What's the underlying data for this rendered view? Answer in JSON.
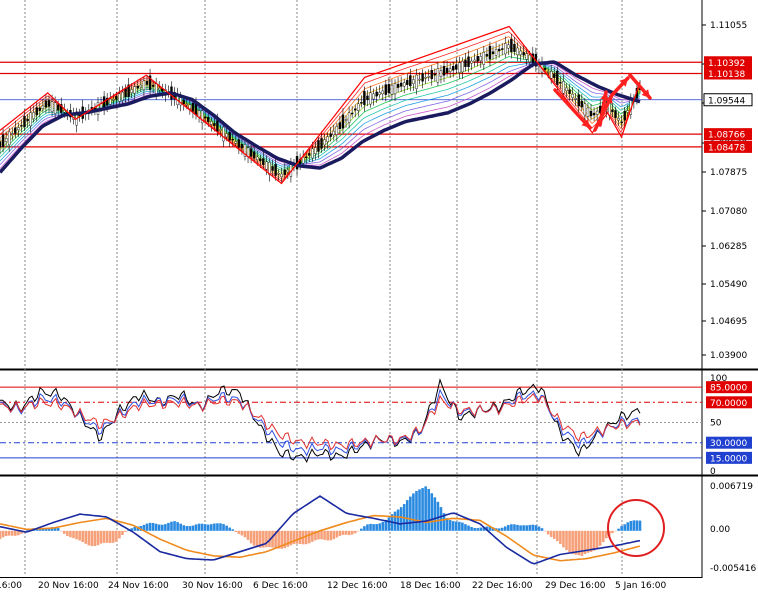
{
  "chart_data": [
    {
      "type": "candlestick",
      "ylim": [
        1.035,
        1.118
      ],
      "y_ticks": [
        "1.11055",
        "1.10260",
        "1.09465",
        "1.08670",
        "1.07875",
        "1.07080",
        "1.06285",
        "1.05490",
        "1.04695",
        "1.03900"
      ],
      "h_levels": [
        {
          "label": "1.10392",
          "value": 1.10392,
          "color": "#e00000"
        },
        {
          "label": "1.10138",
          "value": 1.10138,
          "color": "#e00000"
        },
        {
          "label": "1.09544",
          "value": 1.09544,
          "color": "#2040d0",
          "current": true
        },
        {
          "label": "1.08766",
          "value": 1.08766,
          "color": "#e00000"
        },
        {
          "label": "1.08478",
          "value": 1.08478,
          "color": "#e00000"
        }
      ],
      "x_labels": [
        "16:00",
        "20 Nov 16:00",
        "24 Nov 16:00",
        "30 Nov 16:00",
        "6 Dec 16:00",
        "12 Dec 16:00",
        "18 Dec 16:00",
        "22 Dec 16:00",
        "29 Dec 16:00",
        "5 Jan 16:00"
      ],
      "slow_ma": [
        1.079,
        1.0845,
        1.0895,
        1.092,
        1.0925,
        1.0935,
        1.0945,
        1.0962,
        1.097,
        1.0955,
        1.092,
        1.088,
        1.085,
        1.0822,
        1.0805,
        1.08,
        1.0822,
        1.086,
        1.0885,
        1.0905,
        1.0915,
        1.0925,
        1.0945,
        1.097,
        1.1,
        1.1035,
        1.104,
        1.101,
        1.0985,
        1.0965,
        1.095
      ],
      "zigzag": [
        [
          0,
          1.0885
        ],
        [
          3.1,
          1.097
        ],
        [
          4.9,
          1.091
        ],
        [
          9.5,
          1.101
        ],
        [
          18.3,
          1.0765
        ],
        [
          23.7,
          1.1005
        ],
        [
          33.1,
          1.112
        ],
        [
          38.5,
          1.088
        ],
        [
          39.5,
          1.0925
        ],
        [
          40.4,
          1.087
        ],
        [
          41.6,
          1.0995
        ]
      ]
    },
    {
      "type": "line",
      "ylim": [
        0,
        100
      ],
      "y_ticks": [
        "100",
        "50",
        "0"
      ],
      "levels": [
        {
          "label": "85.0000",
          "value": 85,
          "color": "#e00000"
        },
        {
          "label": "70.0000",
          "value": 70,
          "color": "#e00000"
        },
        {
          "label": "30.0000",
          "value": 30,
          "color": "#2040d0"
        },
        {
          "label": "15.0000",
          "value": 15,
          "color": "#2040d0"
        }
      ],
      "series": [
        {
          "color": "#000000",
          "values": [
            70,
            64,
            80,
            78,
            55,
            35,
            62,
            78,
            70,
            78,
            65,
            82,
            80,
            45,
            20,
            15,
            20,
            16,
            25,
            34,
            30,
            40,
            88,
            55,
            62,
            66,
            80,
            86,
            40,
            20,
            40,
            55,
            62
          ]
        },
        {
          "color": "#3050e0",
          "values": [
            68,
            62,
            74,
            72,
            56,
            42,
            58,
            72,
            70,
            74,
            66,
            76,
            72,
            50,
            30,
            22,
            25,
            22,
            28,
            33,
            32,
            40,
            78,
            60,
            62,
            64,
            76,
            78,
            45,
            28,
            40,
            50,
            52
          ]
        },
        {
          "color": "#e03030",
          "values": [
            66,
            64,
            70,
            68,
            58,
            48,
            56,
            68,
            68,
            70,
            66,
            72,
            70,
            54,
            38,
            30,
            30,
            27,
            30,
            33,
            33,
            42,
            72,
            62,
            62,
            64,
            72,
            76,
            50,
            35,
            42,
            48,
            50
          ]
        }
      ]
    },
    {
      "type": "bar",
      "ylim": [
        -0.0065,
        0.0076
      ],
      "y_ticks": [
        "0.006719",
        "0.00",
        "-0.005416"
      ],
      "histogram": [
        -0.0012,
        -0.0004,
        0.0005,
        0.0003,
        -0.0015,
        -0.0022,
        -0.0014,
        0.0008,
        0.001,
        0.0012,
        0.0007,
        0.0012,
        0.0004,
        -0.002,
        -0.0026,
        -0.0022,
        -0.0016,
        -0.0012,
        -0.0006,
        0.0008,
        0.0016,
        0.0045,
        0.0067,
        0.002,
        0.0008,
        0.0004,
        0.0006,
        0.001,
        0.0004,
        -0.0024,
        -0.0038,
        -0.002,
        0.0008,
        0.0016
      ],
      "signal_line": [
        0.001,
        0.0002,
        0.0004,
        0.0012,
        0.0018,
        0.0008,
        -0.0012,
        -0.0028,
        -0.0036,
        -0.0038,
        -0.003,
        -0.0015,
        0.0,
        0.0012,
        0.0022,
        0.002,
        0.0012,
        0.0018,
        0.0015,
        -0.0008,
        -0.0035,
        -0.0043,
        -0.004,
        -0.0032,
        -0.0022
      ],
      "macd_line": [
        0.0006,
        -0.0002,
        0.0012,
        0.0024,
        0.002,
        -0.0002,
        -0.003,
        -0.004,
        -0.0042,
        -0.003,
        -0.0018,
        0.0025,
        0.005,
        0.0025,
        0.0018,
        0.001,
        0.0014,
        0.0026,
        0.001,
        -0.0024,
        -0.0048,
        -0.0034,
        -0.0028,
        -0.0022,
        -0.0014
      ]
    }
  ]
}
